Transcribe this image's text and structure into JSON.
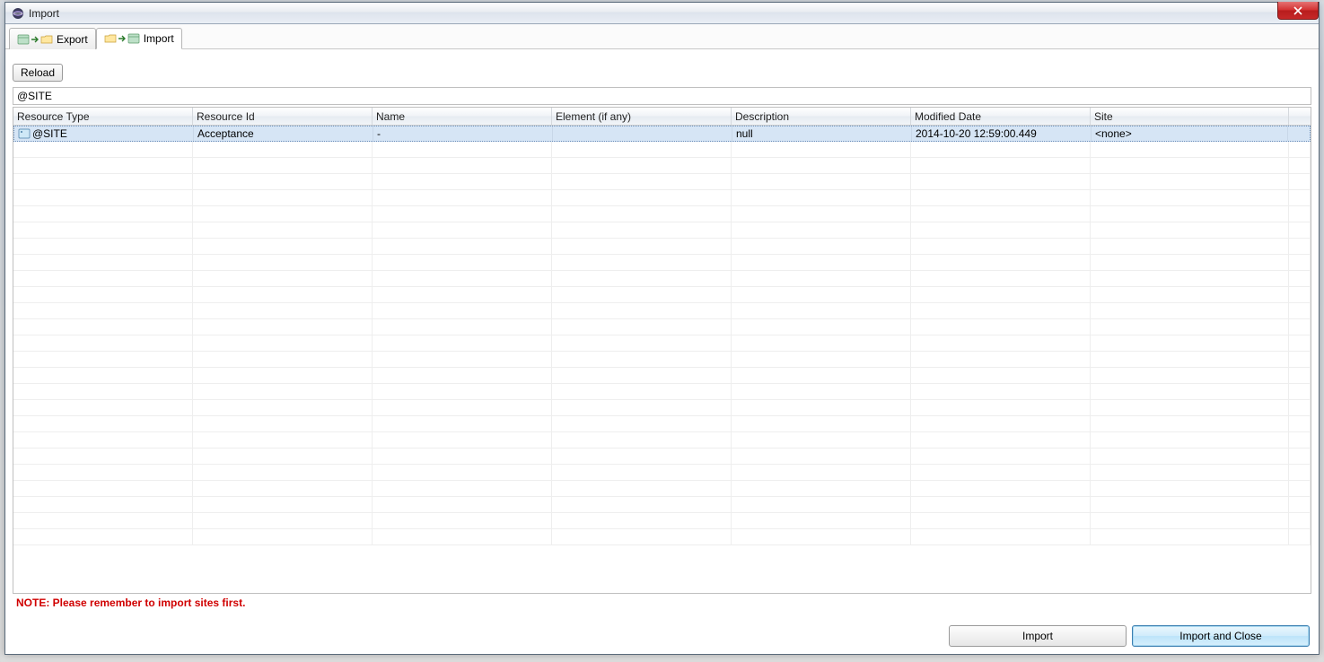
{
  "window": {
    "title": "Import"
  },
  "tabs": {
    "export_label": "Export",
    "import_label": "Import"
  },
  "toolbar": {
    "reload_label": "Reload"
  },
  "filter": {
    "text": "@SITE"
  },
  "table": {
    "columns": [
      "Resource Type",
      "Resource Id",
      "Name",
      "Element (if any)",
      "Description",
      "Modified Date",
      "Site"
    ],
    "rows": [
      {
        "resource_type": "@SITE",
        "resource_id": "Acceptance",
        "name": "-",
        "element": "",
        "description": "null",
        "modified_date": "2014-10-20 12:59:00.449",
        "site": "<none>"
      }
    ]
  },
  "note": "NOTE: Please remember to import sites first.",
  "footer": {
    "import_label": "Import",
    "import_close_label": "Import and Close"
  }
}
